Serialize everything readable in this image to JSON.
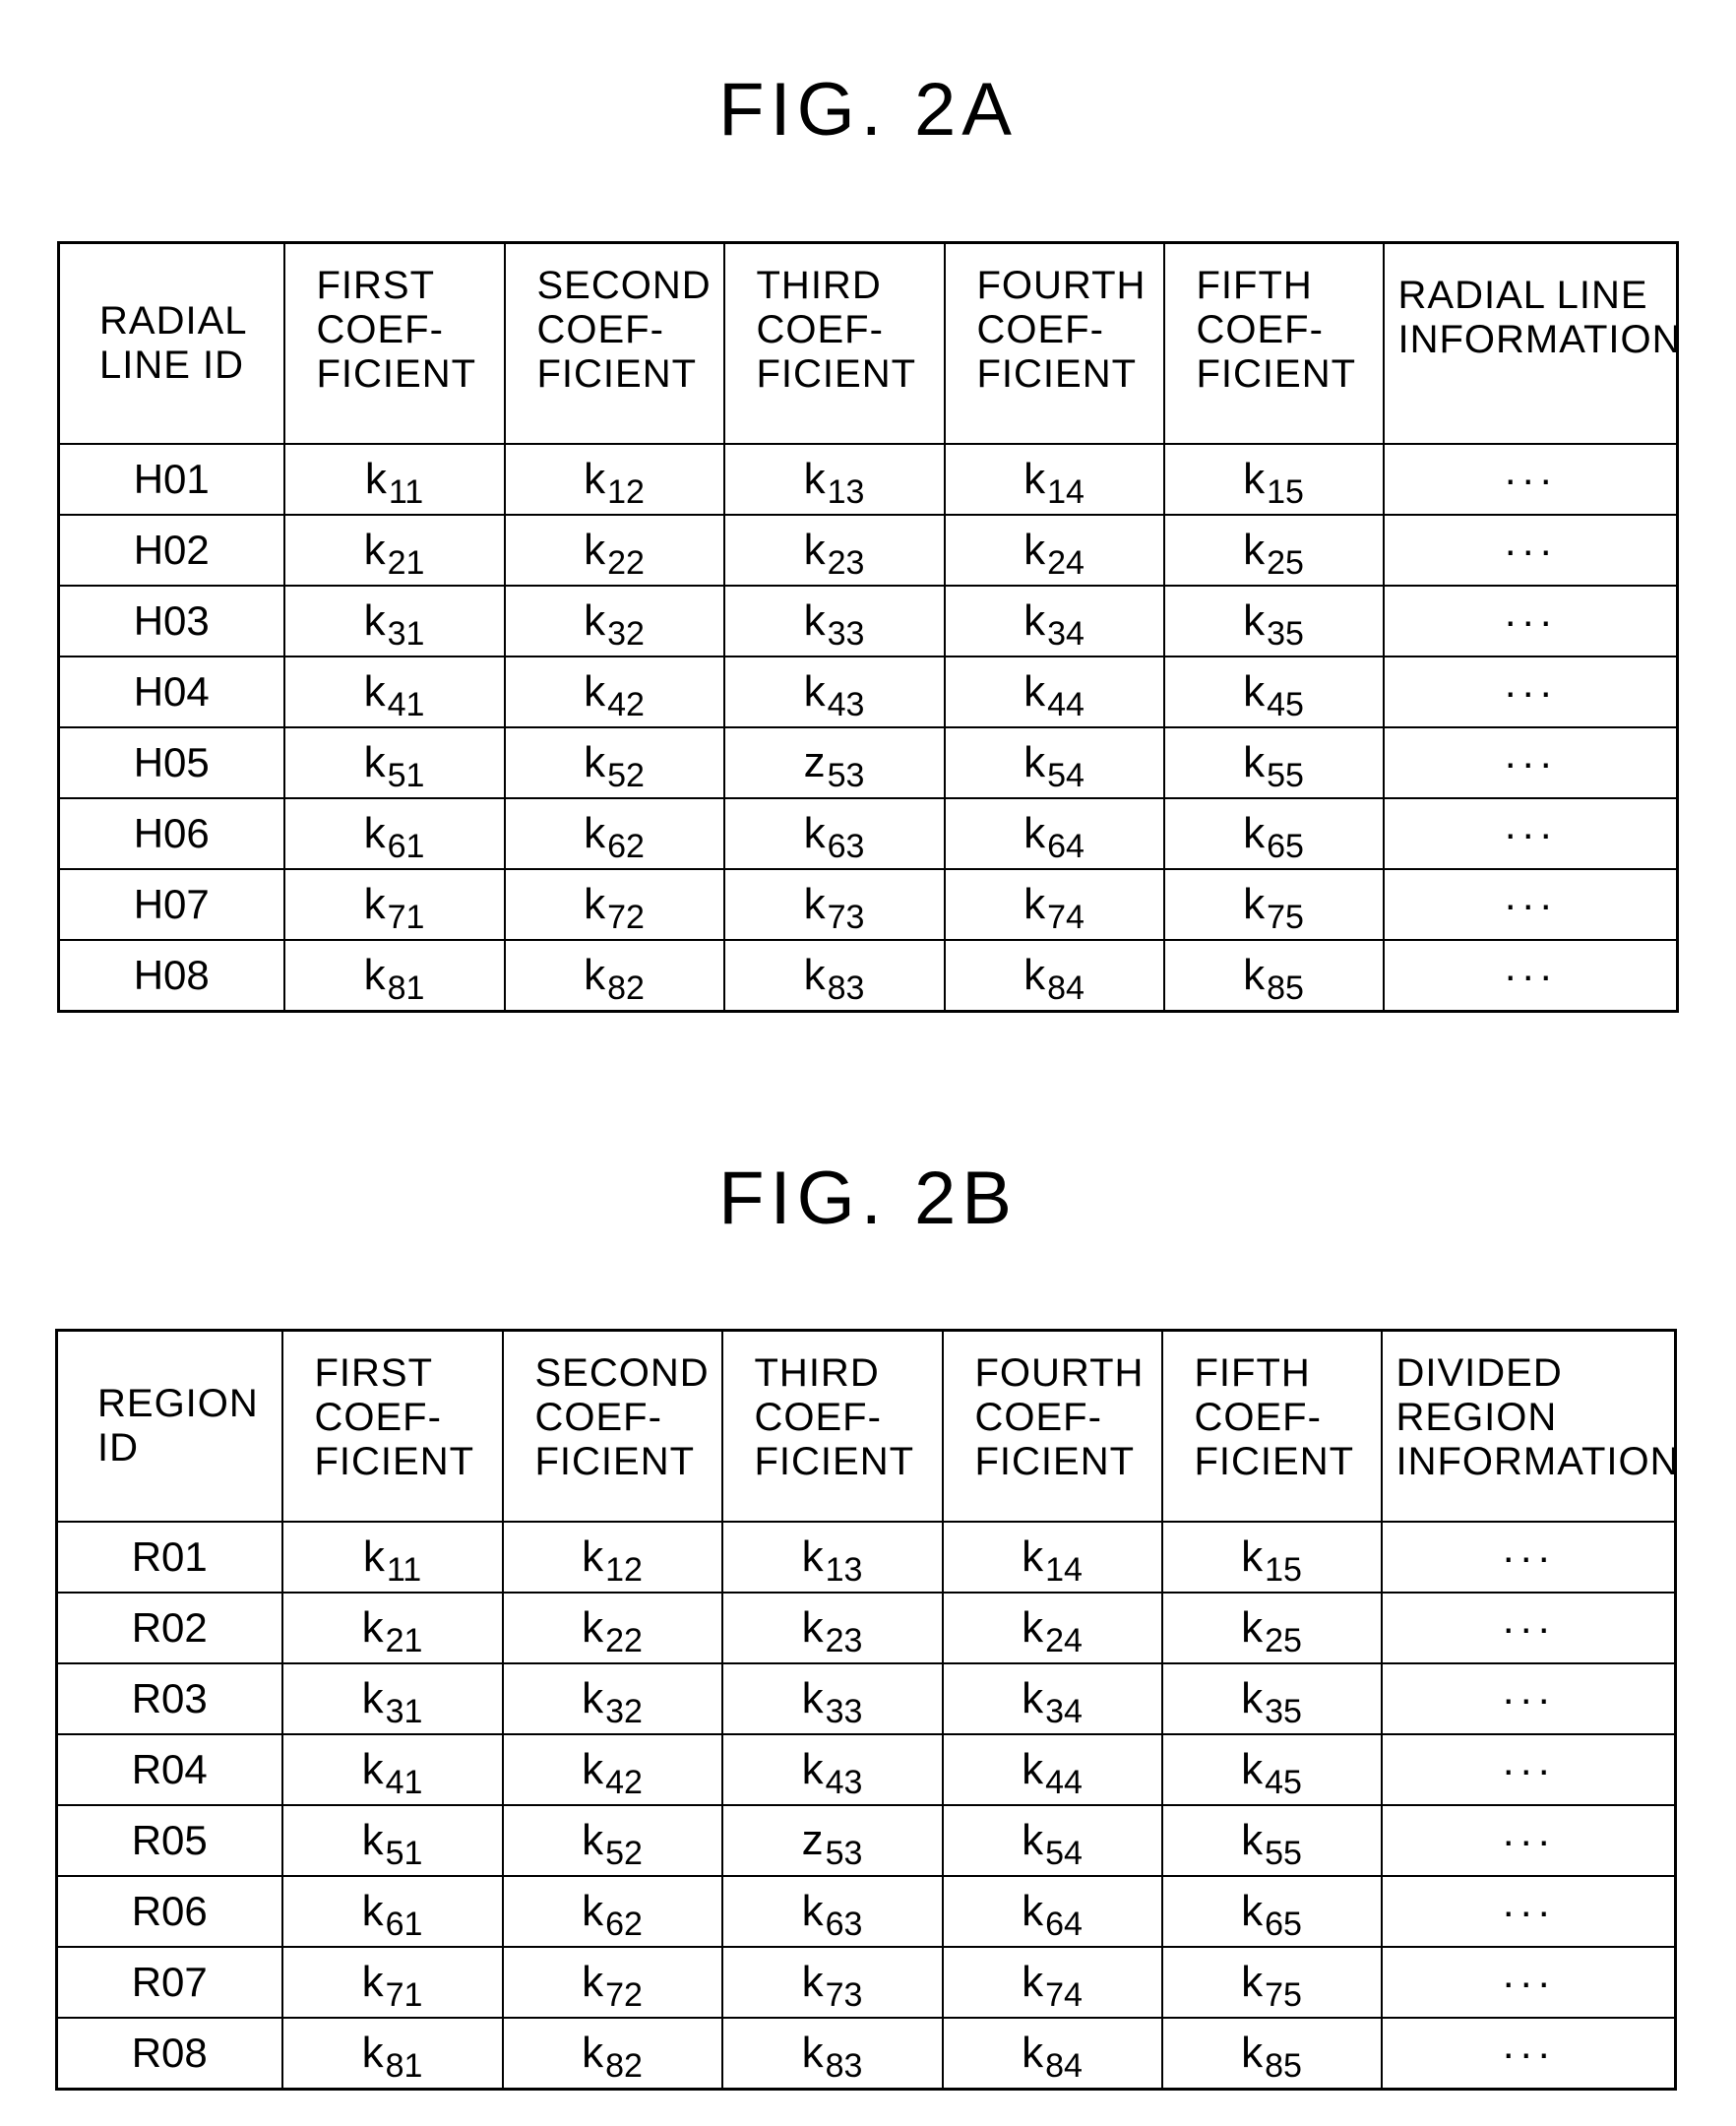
{
  "figures": [
    {
      "title": "FIG. 2A",
      "headers": [
        "RADIAL\nLINE ID",
        "FIRST\nCOEF-\nFICIENT",
        "SECOND\nCOEF-\nFICIENT",
        "THIRD\nCOEF-\nFICIENT",
        "FOURTH\nCOEF-\nFICIENT",
        "FIFTH\nCOEF-\nFICIENT",
        "RADIAL LINE\nINFORMATION"
      ],
      "rows": [
        {
          "id": "H01",
          "coefs": [
            [
              "k",
              "11"
            ],
            [
              "k",
              "12"
            ],
            [
              "k",
              "13"
            ],
            [
              "k",
              "14"
            ],
            [
              "k",
              "15"
            ]
          ],
          "info": "···"
        },
        {
          "id": "H02",
          "coefs": [
            [
              "k",
              "21"
            ],
            [
              "k",
              "22"
            ],
            [
              "k",
              "23"
            ],
            [
              "k",
              "24"
            ],
            [
              "k",
              "25"
            ]
          ],
          "info": "···"
        },
        {
          "id": "H03",
          "coefs": [
            [
              "k",
              "31"
            ],
            [
              "k",
              "32"
            ],
            [
              "k",
              "33"
            ],
            [
              "k",
              "34"
            ],
            [
              "k",
              "35"
            ]
          ],
          "info": "···"
        },
        {
          "id": "H04",
          "coefs": [
            [
              "k",
              "41"
            ],
            [
              "k",
              "42"
            ],
            [
              "k",
              "43"
            ],
            [
              "k",
              "44"
            ],
            [
              "k",
              "45"
            ]
          ],
          "info": "···"
        },
        {
          "id": "H05",
          "coefs": [
            [
              "k",
              "51"
            ],
            [
              "k",
              "52"
            ],
            [
              "z",
              "53"
            ],
            [
              "k",
              "54"
            ],
            [
              "k",
              "55"
            ]
          ],
          "info": "···"
        },
        {
          "id": "H06",
          "coefs": [
            [
              "k",
              "61"
            ],
            [
              "k",
              "62"
            ],
            [
              "k",
              "63"
            ],
            [
              "k",
              "64"
            ],
            [
              "k",
              "65"
            ]
          ],
          "info": "···"
        },
        {
          "id": "H07",
          "coefs": [
            [
              "k",
              "71"
            ],
            [
              "k",
              "72"
            ],
            [
              "k",
              "73"
            ],
            [
              "k",
              "74"
            ],
            [
              "k",
              "75"
            ]
          ],
          "info": "···"
        },
        {
          "id": "H08",
          "coefs": [
            [
              "k",
              "81"
            ],
            [
              "k",
              "82"
            ],
            [
              "k",
              "83"
            ],
            [
              "k",
              "84"
            ],
            [
              "k",
              "85"
            ]
          ],
          "info": "···"
        }
      ]
    },
    {
      "title": "FIG. 2B",
      "headers": [
        "REGION\nID",
        "FIRST\nCOEF-\nFICIENT",
        "SECOND\nCOEF-\nFICIENT",
        "THIRD\nCOEF-\nFICIENT",
        "FOURTH\nCOEF-\nFICIENT",
        "FIFTH\nCOEF-\nFICIENT",
        "DIVIDED\nREGION\nINFORMATION"
      ],
      "rows": [
        {
          "id": "R01",
          "coefs": [
            [
              "k",
              "11"
            ],
            [
              "k",
              "12"
            ],
            [
              "k",
              "13"
            ],
            [
              "k",
              "14"
            ],
            [
              "k",
              "15"
            ]
          ],
          "info": "···"
        },
        {
          "id": "R02",
          "coefs": [
            [
              "k",
              "21"
            ],
            [
              "k",
              "22"
            ],
            [
              "k",
              "23"
            ],
            [
              "k",
              "24"
            ],
            [
              "k",
              "25"
            ]
          ],
          "info": "···"
        },
        {
          "id": "R03",
          "coefs": [
            [
              "k",
              "31"
            ],
            [
              "k",
              "32"
            ],
            [
              "k",
              "33"
            ],
            [
              "k",
              "34"
            ],
            [
              "k",
              "35"
            ]
          ],
          "info": "···"
        },
        {
          "id": "R04",
          "coefs": [
            [
              "k",
              "41"
            ],
            [
              "k",
              "42"
            ],
            [
              "k",
              "43"
            ],
            [
              "k",
              "44"
            ],
            [
              "k",
              "45"
            ]
          ],
          "info": "···"
        },
        {
          "id": "R05",
          "coefs": [
            [
              "k",
              "51"
            ],
            [
              "k",
              "52"
            ],
            [
              "z",
              "53"
            ],
            [
              "k",
              "54"
            ],
            [
              "k",
              "55"
            ]
          ],
          "info": "···"
        },
        {
          "id": "R06",
          "coefs": [
            [
              "k",
              "61"
            ],
            [
              "k",
              "62"
            ],
            [
              "k",
              "63"
            ],
            [
              "k",
              "64"
            ],
            [
              "k",
              "65"
            ]
          ],
          "info": "···"
        },
        {
          "id": "R07",
          "coefs": [
            [
              "k",
              "71"
            ],
            [
              "k",
              "72"
            ],
            [
              "k",
              "73"
            ],
            [
              "k",
              "74"
            ],
            [
              "k",
              "75"
            ]
          ],
          "info": "···"
        },
        {
          "id": "R08",
          "coefs": [
            [
              "k",
              "81"
            ],
            [
              "k",
              "82"
            ],
            [
              "k",
              "83"
            ],
            [
              "k",
              "84"
            ],
            [
              "k",
              "85"
            ]
          ],
          "info": "···"
        }
      ]
    }
  ]
}
